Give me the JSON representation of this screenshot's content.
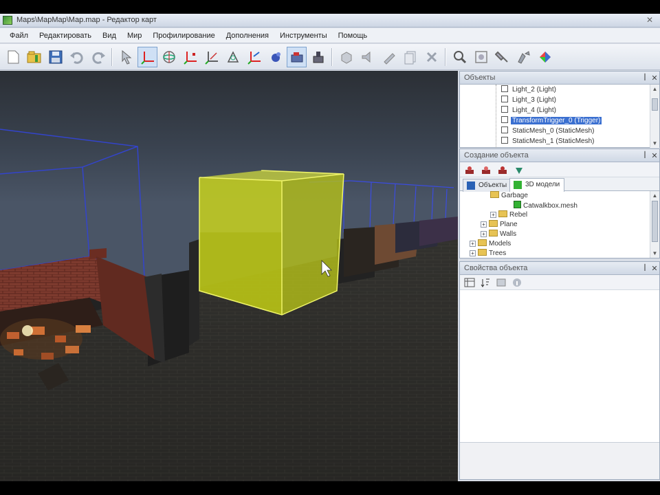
{
  "window": {
    "title": "Maps\\MapMap\\Map.map - Редактор карт"
  },
  "menu": {
    "items": [
      "Файл",
      "Редактировать",
      "Вид",
      "Мир",
      "Профилирование",
      "Дополнения",
      "Инструменты",
      "Помощь"
    ]
  },
  "toolbar": {
    "buttons": [
      "new-icon",
      "open-icon",
      "save-icon",
      "undo-icon",
      "redo-icon",
      "select-icon",
      "move-icon",
      "rotate-icon",
      "scale-icon",
      "axis-icon",
      "vertex-icon",
      "transform-icon",
      "physics-icon",
      "camera-icon",
      "build-icon",
      "cube-icon",
      "sound-icon",
      "particles-icon",
      "copy-icon",
      "delete-icon",
      "zoom-icon",
      "focus-icon",
      "brush-icon",
      "paint-icon",
      "materials-icon"
    ]
  },
  "objects_panel": {
    "title": "Объекты",
    "items": [
      {
        "label": "Light_2 (Light)",
        "selected": false
      },
      {
        "label": "Light_3 (Light)",
        "selected": false
      },
      {
        "label": "Light_4 (Light)",
        "selected": false
      },
      {
        "label": "TransformTrigger_0 (Trigger)",
        "selected": true
      },
      {
        "label": "StaticMesh_0 (StaticMesh)",
        "selected": false
      },
      {
        "label": "StaticMesh_1 (StaticMesh)",
        "selected": false
      }
    ]
  },
  "created_panel": {
    "title": "Создание объекта",
    "tabs": [
      {
        "label": "Объекты"
      },
      {
        "label": "3D модели"
      }
    ],
    "tree": [
      {
        "label": "Garbage",
        "type": "folder"
      },
      {
        "label": "Catwalkbox.mesh",
        "type": "mesh"
      },
      {
        "label": "Rebel",
        "type": "folder"
      },
      {
        "label": "Plane",
        "type": "folder"
      },
      {
        "label": "Walls",
        "type": "folder"
      },
      {
        "label": "Models",
        "type": "folder"
      },
      {
        "label": "Trees",
        "type": "folder"
      }
    ]
  },
  "props_panel": {
    "title": "Свойства объекта"
  },
  "colors": {
    "selection": "#3a6fd0",
    "trigger_volume": "#c8d21e",
    "wire_boxes": "#3344cc"
  }
}
